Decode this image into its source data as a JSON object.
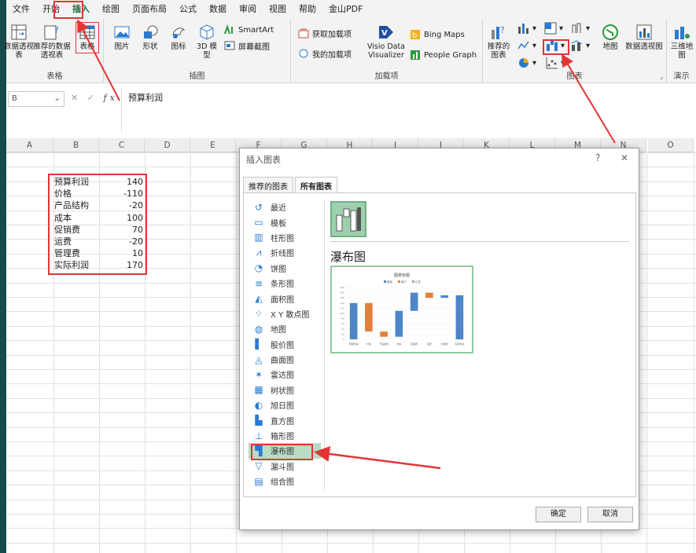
{
  "menu": [
    "文件",
    "开始",
    "插入",
    "绘图",
    "页面布局",
    "公式",
    "数据",
    "审阅",
    "视图",
    "帮助",
    "金山PDF"
  ],
  "ribbon": {
    "groups": {
      "table": "表格",
      "illustrations": "插图",
      "addins": "加载项",
      "charts": "图表",
      "tours": "演示"
    },
    "table_buttons": [
      "数据透视表",
      "推荐的数据透视表",
      "表格"
    ],
    "illus_buttons": [
      "图片",
      "形状",
      "图标",
      "3D 模型"
    ],
    "smartart": "SmartArt",
    "screenshot": "屏幕截图",
    "get_addins": "获取加载项",
    "my_addins": "我的加载项",
    "visio": "Visio Data Visualizer",
    "bing": "Bing Maps",
    "people": "People Graph",
    "recommended_charts": "推荐的图表",
    "maps": "地图",
    "pivot_chart": "数据透视图",
    "map3d": "三维地图"
  },
  "formula": {
    "namebox": "B",
    "fx": "fx",
    "content": "预算利润",
    "cancel": "✕",
    "enter": "✓"
  },
  "columns": [
    "A",
    "B",
    "C",
    "D",
    "E",
    "F",
    "G",
    "H",
    "I",
    "J",
    "K",
    "L",
    "M",
    "N",
    "O"
  ],
  "table": [
    {
      "label": "预算利润",
      "value": "140"
    },
    {
      "label": "价格",
      "value": "-110"
    },
    {
      "label": "产品结构",
      "value": "-20"
    },
    {
      "label": "成本",
      "value": "100"
    },
    {
      "label": "促销费",
      "value": "70"
    },
    {
      "label": "运费",
      "value": "-20"
    },
    {
      "label": "管理费",
      "value": "10"
    },
    {
      "label": "实际利润",
      "value": "170"
    }
  ],
  "dialog": {
    "title": "插入图表",
    "help": "?",
    "close": "✕",
    "tabs": [
      "推荐的图表",
      "所有图表"
    ],
    "types": [
      "最近",
      "模板",
      "柱形图",
      "折线图",
      "饼图",
      "条形图",
      "面积图",
      "X Y 散点图",
      "地图",
      "股价图",
      "曲面图",
      "雷达图",
      "树状图",
      "旭日图",
      "直方图",
      "箱形图",
      "瀑布图",
      "漏斗图",
      "组合图"
    ],
    "selected_type": "瀑布图",
    "chart_name": "瀑布图",
    "ok": "确定",
    "cancel": "取消"
  },
  "preview": {
    "title": "图表标题",
    "legend": [
      "增加",
      "减少",
      "汇总"
    ],
    "colors": {
      "increase": "#4e86c6",
      "decrease": "#e2803a",
      "total": "#9aa6b3"
    },
    "yticks": [
      "200",
      "180",
      "160",
      "140",
      "120",
      "100",
      "80",
      "60",
      "40",
      "20",
      "0"
    ],
    "xcats": [
      "预算利润",
      "价格",
      "产品结构",
      "成本",
      "促销费",
      "运费",
      "管理费",
      "实际利润"
    ]
  },
  "chart_data": {
    "type": "bar",
    "subtype": "waterfall",
    "categories": [
      "预算利润",
      "价格",
      "产品结构",
      "成本",
      "促销费",
      "运费",
      "管理费",
      "实际利润"
    ],
    "values": [
      140,
      -110,
      -20,
      100,
      70,
      -20,
      10,
      170
    ],
    "title": "图表标题",
    "legend": [
      "增加",
      "减少",
      "汇总"
    ],
    "ylim": [
      0,
      200
    ]
  },
  "annotation_color": "#e23535"
}
